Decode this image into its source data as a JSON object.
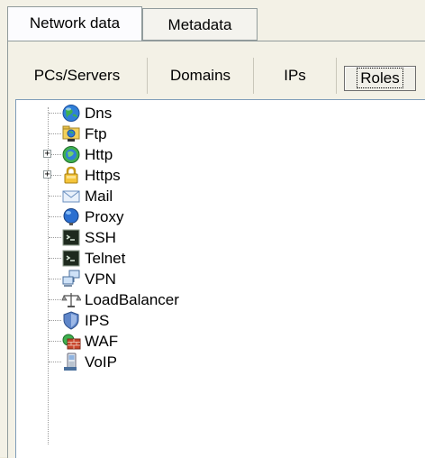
{
  "top_tabs": [
    {
      "label": "Network data",
      "active": true
    },
    {
      "label": "Metadata",
      "active": false
    }
  ],
  "sub_tabs": [
    {
      "label": "PCs/Servers",
      "selected": false
    },
    {
      "label": "Domains",
      "selected": false
    },
    {
      "label": "IPs",
      "selected": false
    },
    {
      "label": "Roles",
      "selected": true
    }
  ],
  "tree": {
    "items": [
      {
        "label": "Dns",
        "icon": "globe-icon",
        "expandable": false
      },
      {
        "label": "Ftp",
        "icon": "ftp-folder-icon",
        "expandable": false
      },
      {
        "label": "Http",
        "icon": "web-globe-icon",
        "expandable": true,
        "expander": "+"
      },
      {
        "label": "Https",
        "icon": "padlock-icon",
        "expandable": true,
        "expander": "+"
      },
      {
        "label": "Mail",
        "icon": "envelope-icon",
        "expandable": false
      },
      {
        "label": "Proxy",
        "icon": "proxy-globe-icon",
        "expandable": false
      },
      {
        "label": "SSH",
        "icon": "terminal-icon",
        "expandable": false
      },
      {
        "label": "Telnet",
        "icon": "terminal-icon",
        "expandable": false
      },
      {
        "label": "VPN",
        "icon": "network-computers-icon",
        "expandable": false
      },
      {
        "label": "LoadBalancer",
        "icon": "scales-icon",
        "expandable": false
      },
      {
        "label": "IPS",
        "icon": "shield-icon",
        "expandable": false
      },
      {
        "label": "WAF",
        "icon": "brick-wall-globe-icon",
        "expandable": false
      },
      {
        "label": "VoIP",
        "icon": "phone-icon",
        "expandable": false
      }
    ]
  }
}
